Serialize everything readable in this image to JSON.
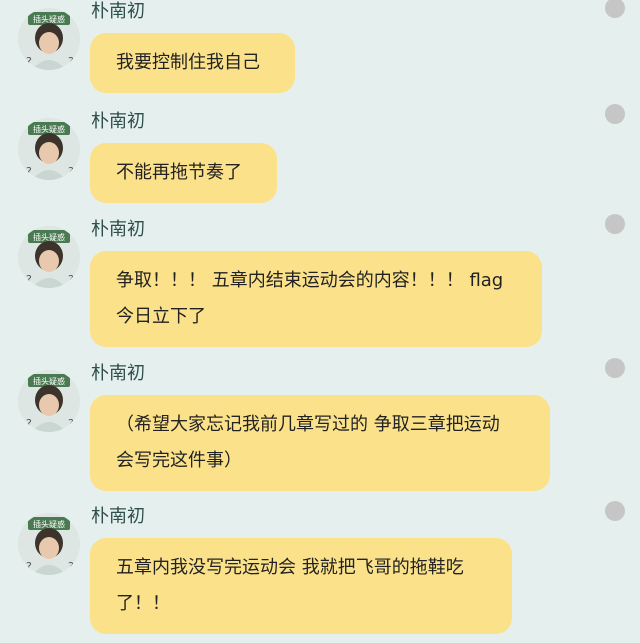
{
  "sender_name": "朴南初",
  "avatar_badge": "插头疑惑",
  "messages": [
    {
      "text": "我要控制住我自己"
    },
    {
      "text": "不能再拖节奏了"
    },
    {
      "text": "争取！！！ 五章内结束运动会的内容！！！ flag\n今日立下了"
    },
    {
      "text": "（希望大家忘记我前几章写过的 争取三章把运动\n会写完这件事）"
    },
    {
      "text": "五章内我没写完运动会 我就把飞哥的拖鞋吃\n了！！"
    }
  ],
  "colors": {
    "background": "#e5f0ee",
    "bubble": "#fbe28a",
    "sender_text": "#2f4f4a",
    "status_dot": "#c6c6c6"
  },
  "icons": {
    "status": "grey-circle-icon"
  }
}
